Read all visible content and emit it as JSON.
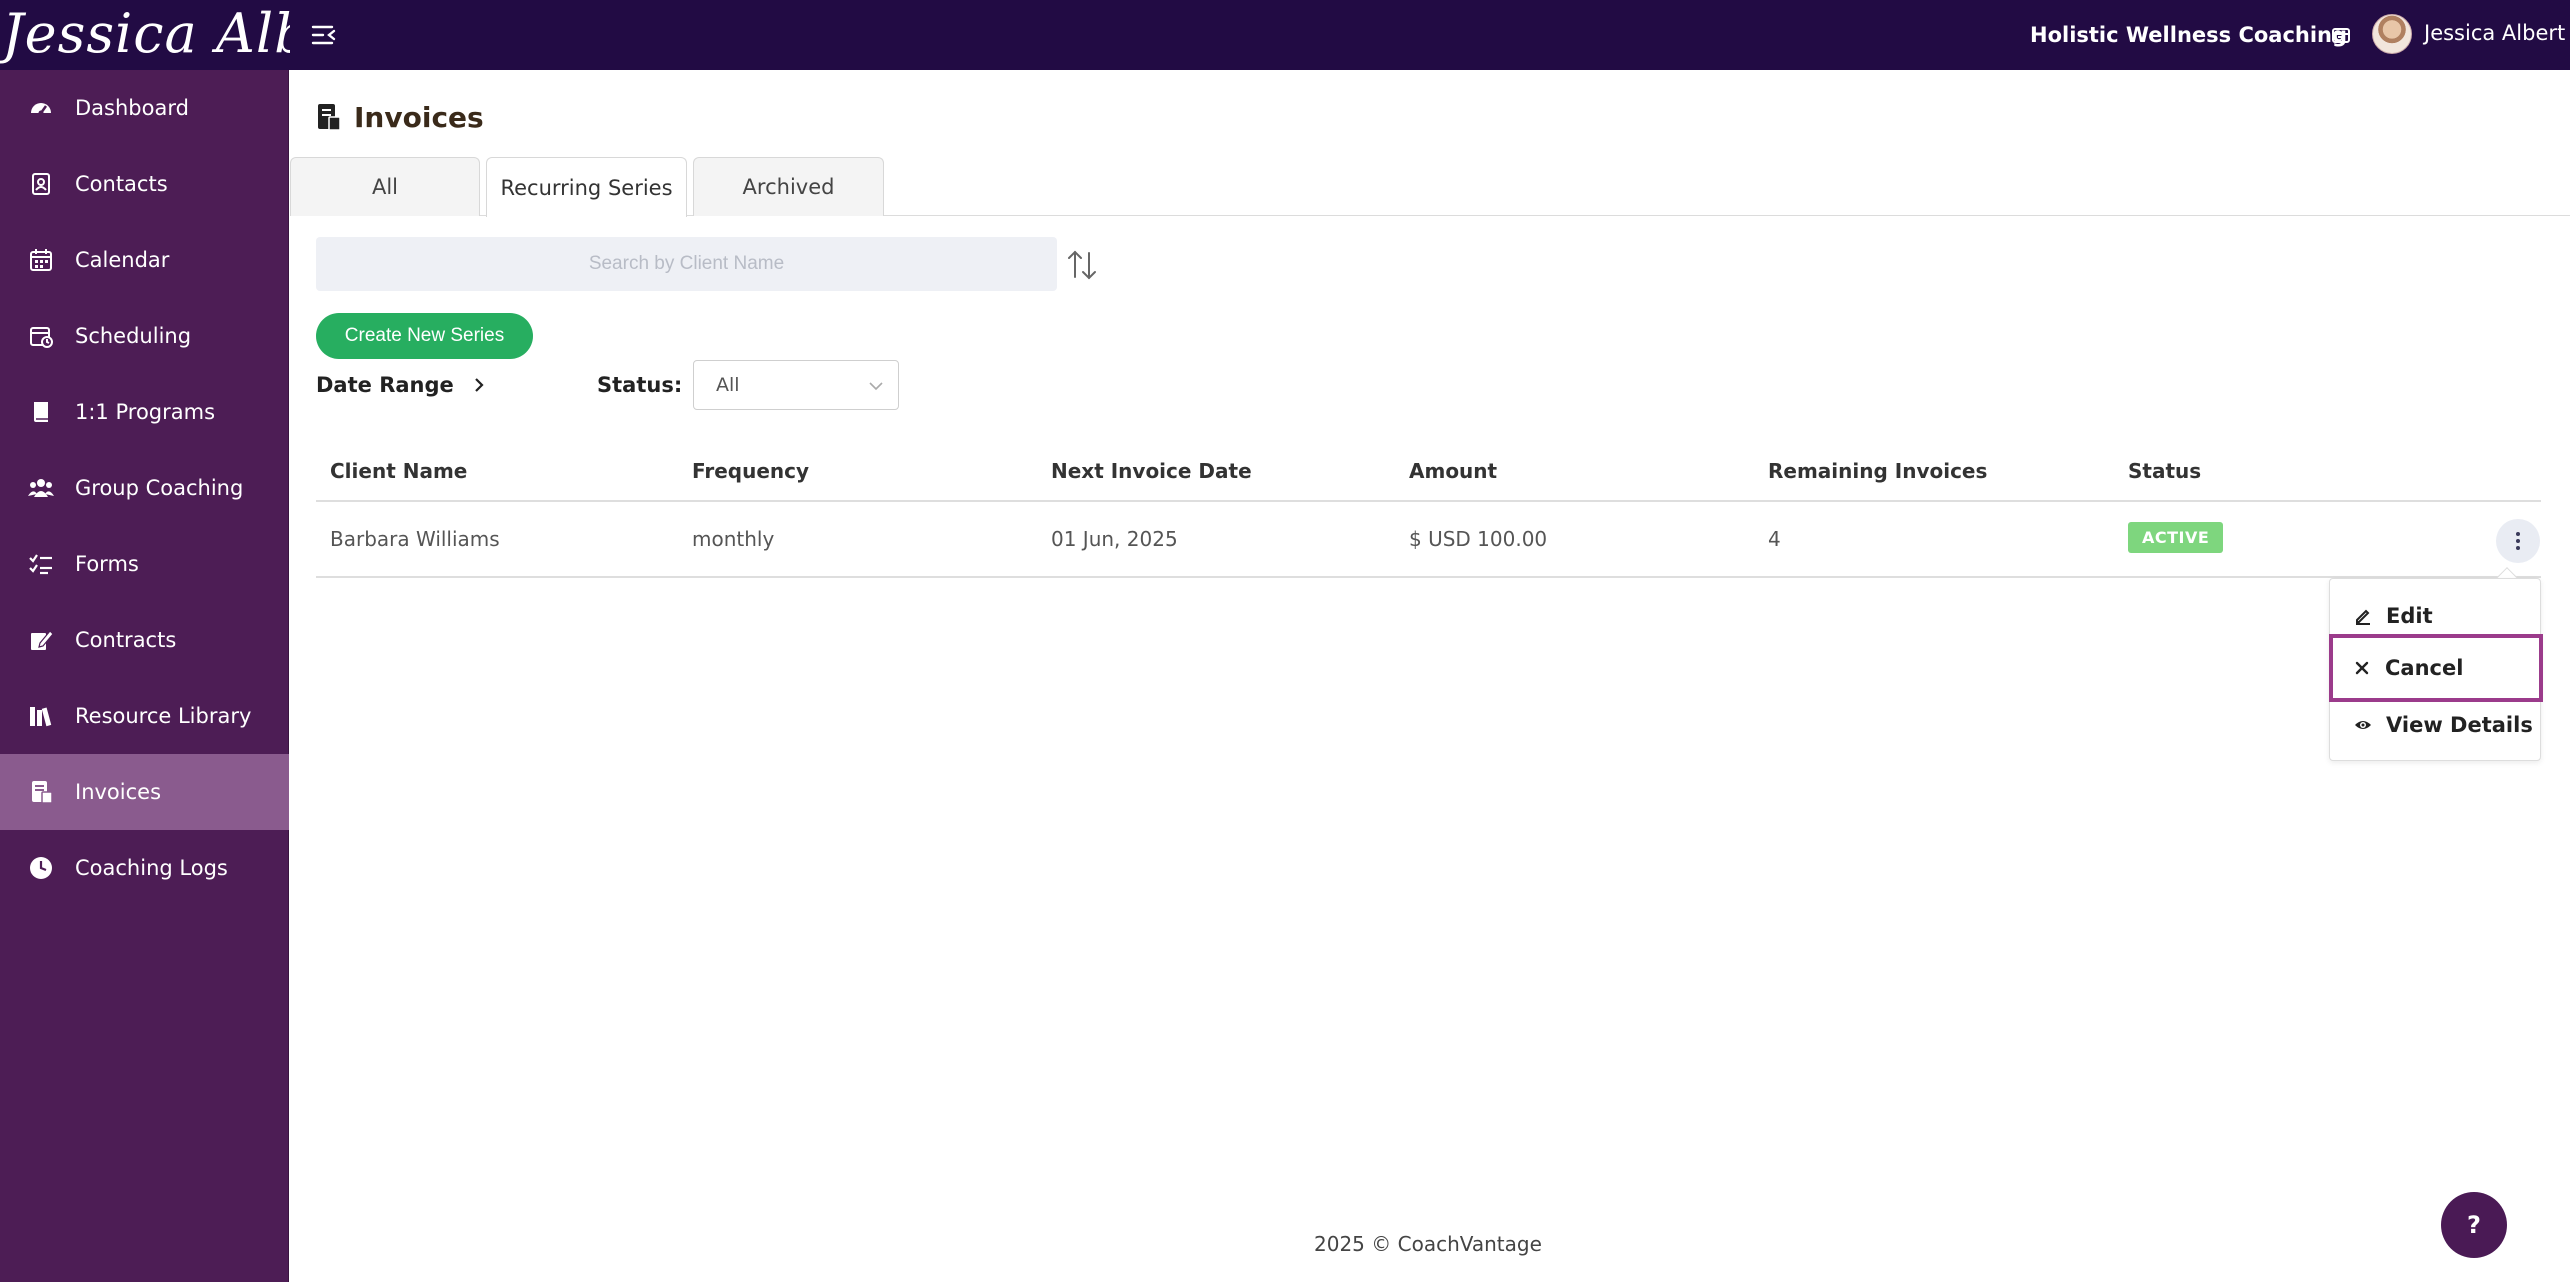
{
  "app": {
    "brand": "Jessica Albert",
    "organization": "Holistic Wellness Coaching",
    "user_name": "Jessica Albert"
  },
  "sidebar": {
    "items": [
      {
        "label": "Dashboard",
        "icon": "dashboard-icon"
      },
      {
        "label": "Contacts",
        "icon": "contacts-icon"
      },
      {
        "label": "Calendar",
        "icon": "calendar-icon"
      },
      {
        "label": "Scheduling",
        "icon": "scheduling-icon"
      },
      {
        "label": "1:1 Programs",
        "icon": "programs-icon"
      },
      {
        "label": "Group Coaching",
        "icon": "group-icon"
      },
      {
        "label": "Forms",
        "icon": "forms-icon"
      },
      {
        "label": "Contracts",
        "icon": "contracts-icon"
      },
      {
        "label": "Resource Library",
        "icon": "library-icon"
      },
      {
        "label": "Invoices",
        "icon": "invoices-icon",
        "active": true
      },
      {
        "label": "Coaching Logs",
        "icon": "clock-icon"
      }
    ]
  },
  "main": {
    "title": "Invoices",
    "tabs": [
      {
        "label": "All"
      },
      {
        "label": "Recurring Series",
        "active": true
      },
      {
        "label": "Archived"
      }
    ],
    "search_placeholder": "Search by Client Name",
    "create_button": "Create New Series",
    "date_range_label": "Date Range",
    "status_label": "Status:",
    "status_value": "All"
  },
  "table": {
    "headers": [
      "Client Name",
      "Frequency",
      "Next Invoice Date",
      "Amount",
      "Remaining Invoices",
      "Status"
    ],
    "rows": [
      {
        "client": "Barbara Williams",
        "frequency": "monthly",
        "next_date": "01 Jun, 2025",
        "amount": "$ USD 100.00",
        "remaining": "4",
        "status": "ACTIVE"
      }
    ]
  },
  "row_menu": {
    "items": [
      "Edit",
      "Cancel",
      "View Details"
    ],
    "highlighted": "Cancel"
  },
  "footer": "2025 © CoachVantage",
  "help_label": "?",
  "colors": {
    "topbar": "#220b44",
    "sidebar": "#4d1d55",
    "sidebar_active": "#8a5b8e",
    "primary_button": "#27ae60",
    "active_badge": "#7ed67e",
    "highlight_border": "#9b3b8b"
  }
}
